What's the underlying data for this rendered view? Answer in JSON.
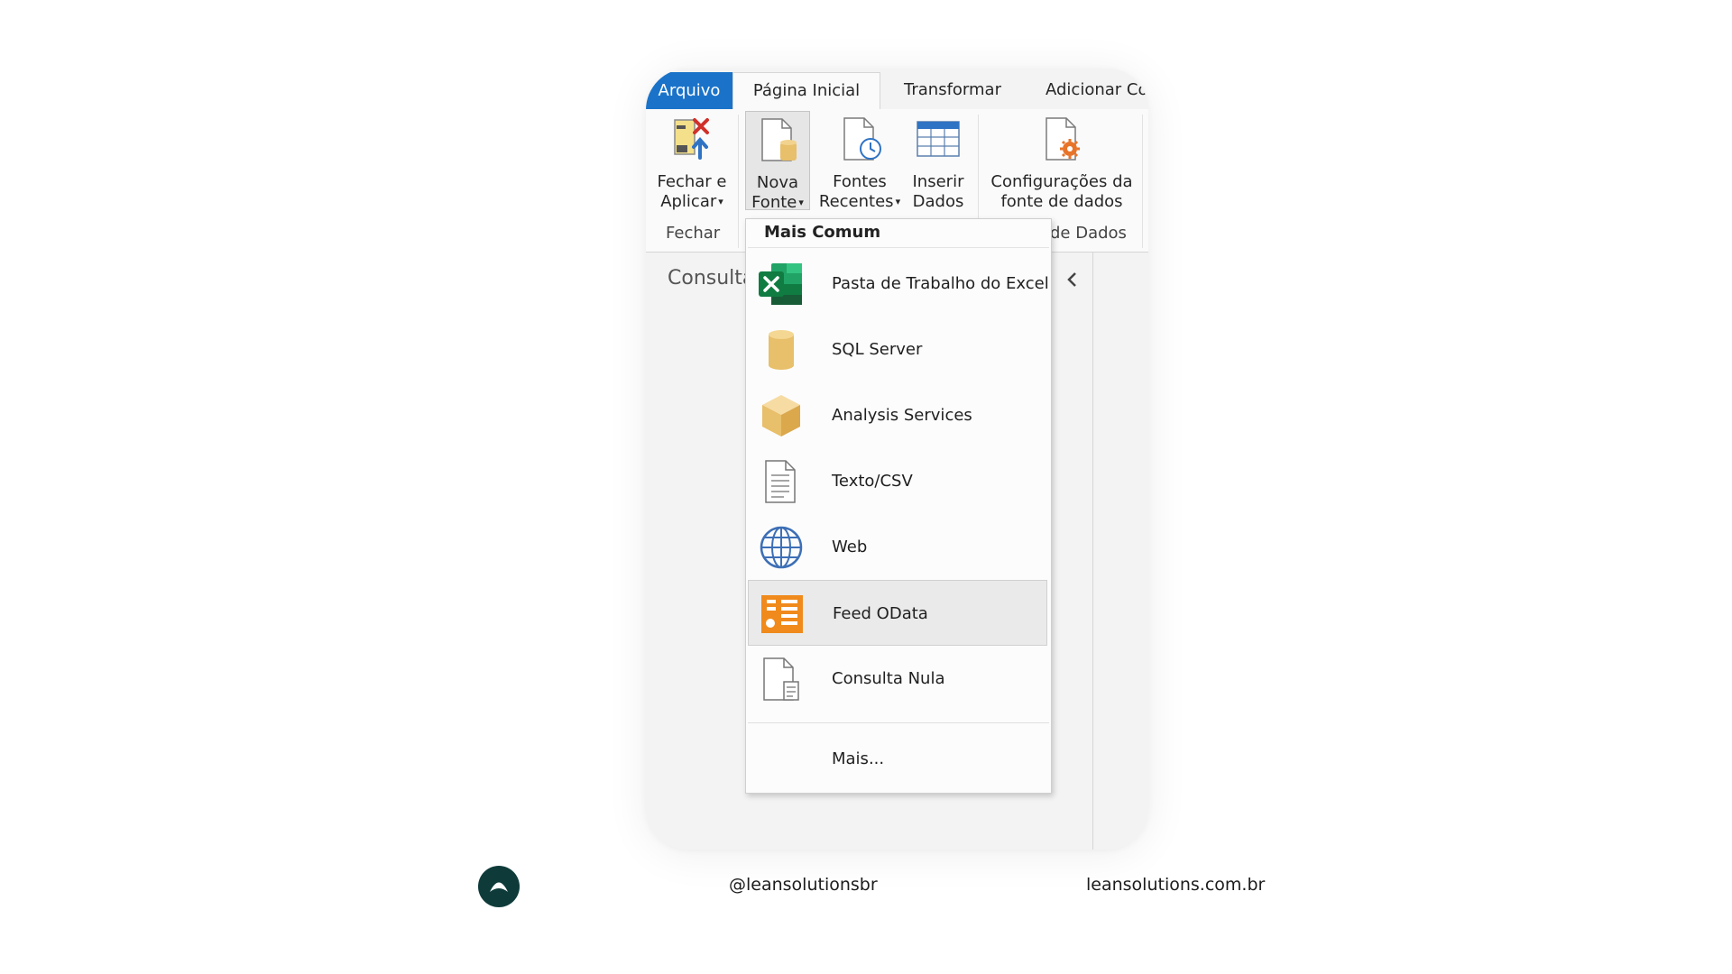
{
  "tabs": {
    "file": "Arquivo",
    "home": "Página Inicial",
    "transform": "Transformar",
    "add_column": "Adicionar Co"
  },
  "ribbon": {
    "close_apply": {
      "line1": "Fechar e",
      "line2": "Aplicar",
      "caret": "▾"
    },
    "new_source": {
      "line1": "Nova",
      "line2": "Fonte",
      "caret": "▾"
    },
    "recent_sources": {
      "line1": "Fontes",
      "line2": "Recentes",
      "caret": "▾"
    },
    "enter_data": {
      "line1": "Inserir",
      "line2": "Dados"
    },
    "data_source_settings": {
      "line1": "Configurações da",
      "line2": "fonte de dados"
    },
    "group_close": "Fechar",
    "group_data_sources": "de Dados"
  },
  "queries_panel": {
    "title": "Consulta"
  },
  "new_source_menu": {
    "header": "Mais Comum",
    "items": [
      {
        "label": "Pasta de Trabalho do Excel",
        "icon": "excel-icon"
      },
      {
        "label": "SQL Server",
        "icon": "database-icon"
      },
      {
        "label": "Analysis Services",
        "icon": "cube-icon"
      },
      {
        "label": "Texto/CSV",
        "icon": "text-file-icon"
      },
      {
        "label": "Web",
        "icon": "globe-icon"
      },
      {
        "label": "Feed OData",
        "icon": "odata-feed-icon",
        "highlighted": true
      },
      {
        "label": "Consulta Nula",
        "icon": "blank-query-icon"
      }
    ],
    "more": "Mais..."
  },
  "footer": {
    "handle": "@leansolutionsbr",
    "site": "leansolutions.com.br"
  },
  "colors": {
    "file_tab": "#1a73c9",
    "excel_green": "#1d7a45",
    "odata_orange": "#f08a1c",
    "db_gold": "#e8bf6a",
    "logo_dark": "#0e3b3a"
  }
}
